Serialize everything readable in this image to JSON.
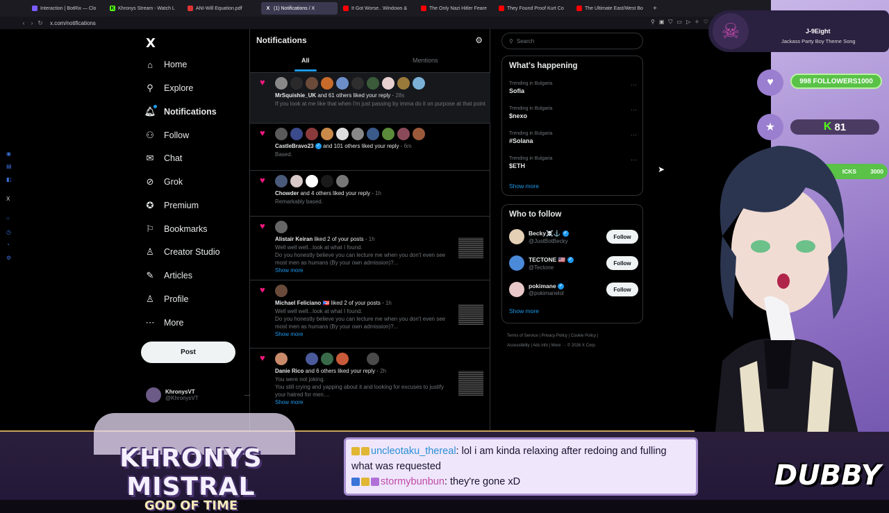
{
  "browser": {
    "tabs": [
      {
        "label": "Interaction | BotRix — Clo",
        "icon": "botrix-icon",
        "active": false
      },
      {
        "label": "Khronys Stream - Watch L",
        "icon": "kick-icon",
        "active": false
      },
      {
        "label": "ANI-Will Equation.pdf",
        "icon": "pdf-icon",
        "active": false
      },
      {
        "label": "(1) Notifications / X",
        "icon": "x-icon",
        "active": true
      },
      {
        "label": "It Got Worse.. Windows &",
        "icon": "youtube-icon",
        "active": false
      },
      {
        "label": "The Only Nazi Hitler Feare",
        "icon": "youtube-icon",
        "active": false
      },
      {
        "label": "They Found Proof Kurt Co",
        "icon": "youtube-icon",
        "active": false
      },
      {
        "label": "The Ultimate East/West Bo",
        "icon": "youtube-icon",
        "active": false
      }
    ],
    "new_tab": "+",
    "url": "x.com/notifications"
  },
  "sidebar": {
    "logo": "X",
    "items": [
      {
        "label": "Home",
        "icon": "home-icon"
      },
      {
        "label": "Explore",
        "icon": "search-icon"
      },
      {
        "label": "Notifications",
        "icon": "bell-icon"
      },
      {
        "label": "Follow",
        "icon": "follow-icon"
      },
      {
        "label": "Chat",
        "icon": "mail-icon"
      },
      {
        "label": "Grok",
        "icon": "grok-icon"
      },
      {
        "label": "Premium",
        "icon": "premium-icon"
      },
      {
        "label": "Bookmarks",
        "icon": "bookmark-icon"
      },
      {
        "label": "Creator Studio",
        "icon": "creator-icon"
      },
      {
        "label": "Articles",
        "icon": "articles-icon"
      },
      {
        "label": "Profile",
        "icon": "profile-icon"
      },
      {
        "label": "More",
        "icon": "more-icon"
      }
    ],
    "post_button": "Post",
    "account": {
      "name": "KhronysVT",
      "handle": "@KhronysVT",
      "more": "···"
    }
  },
  "center": {
    "title": "Notifications",
    "tabs": [
      "All",
      "Mentions"
    ],
    "notifications": [
      {
        "user": "MrSquishie_UK",
        "text": "and 61 others liked your reply",
        "time": "28s",
        "sub": "If you look at me like that when I'm just passing by imma do it on purpose at that point"
      },
      {
        "user": "CastleBravo23",
        "text": "and 101 others liked your reply",
        "time": "6m",
        "sub": "Based."
      },
      {
        "user": "Chowder",
        "text": "and 4 others liked your reply",
        "time": "1h",
        "sub": "Remarkably based."
      },
      {
        "user": "Alistair Keiran",
        "text": "liked 2 of your posts",
        "time": "1h",
        "sub": "Well well well...look at what I found.",
        "sub2": "Do you honestly believe you can lecture me when you don't even see most men as humans (By your own admission)?...",
        "more": "Show more"
      },
      {
        "user": "Michael Feliciano 🇵🇷",
        "text": "liked 2 of your posts",
        "time": "1h",
        "sub": "Well well well...look at what I found.",
        "sub2": "Do you honestly believe you can lecture me when you don't even see most men as humans (By your own admission)?...",
        "more": "Show more"
      },
      {
        "user": "Danie Rico",
        "text": "and 6 others liked your reply",
        "time": "2h",
        "sub": "You were not joking.",
        "sub2": "You still crying and yapping about it and looking for excuses to justify your hatred for men....",
        "more": "Show more"
      }
    ]
  },
  "right": {
    "search_placeholder": "Search",
    "happening_title": "What's happening",
    "trends": [
      {
        "category": "Trending in Bulgaria",
        "name": "Sofia"
      },
      {
        "category": "Trending in Bulgaria",
        "name": "$nexo"
      },
      {
        "category": "Trending in Bulgaria",
        "name": "#Solana"
      },
      {
        "category": "Trending in Bulgaria",
        "name": "$ETH"
      }
    ],
    "show_more": "Show more",
    "who_title": "Who to follow",
    "who": [
      {
        "name": "Becky☠️⚓",
        "handle": "@JustBotBecky",
        "button": "Follow"
      },
      {
        "name": "TECTONE 🇺🇸",
        "handle": "@Tectone",
        "button": "Follow"
      },
      {
        "name": "pokimane",
        "handle": "@pokimanelol",
        "button": "Follow"
      }
    ],
    "who_show_more": "Show more",
    "footer": {
      "line1": "Terms of Service  |  Privacy Policy  |  Cookie Policy  |",
      "line2": "Accessibility  |  Ads info  |  More ···  © 2026 X Corp."
    }
  },
  "overlay": {
    "now_playing": {
      "artist": "J-9Eight",
      "song": "Jackass Party Boy Theme Song"
    },
    "followers_goal": "998 FOLLOWERS1000",
    "kicks_count": "81",
    "kicks_goal": {
      "label": "ICKS",
      "target": "3000"
    },
    "chat": [
      {
        "user": "uncleotaku_thereal",
        "message": "lol i am kinda relaxing after redoing and fulling what was requested"
      },
      {
        "user": "stormybunbun",
        "message": "they're gone xD"
      }
    ],
    "brand_title": "KHRONYS MISTRAL",
    "brand_subtitle": "GOD OF TIME",
    "dubby": "DUBBY"
  },
  "colors": {
    "accent": "#1d9bf0",
    "like": "#f91880",
    "goal_green": "#59c247",
    "gold": "#c9a45b"
  }
}
